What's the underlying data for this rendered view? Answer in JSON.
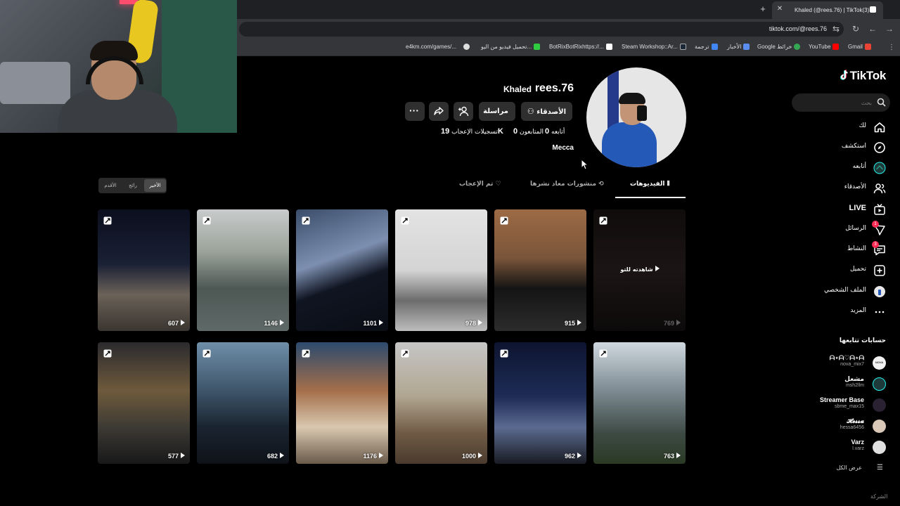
{
  "browser": {
    "tab_title": "Khaled (@rees.76) | TikTok(3)",
    "url": "tiktok.com/@rees.76",
    "bookmarks": [
      "e4km.com/games/...",
      "تحميل فيديو من اليو...",
      "BotRixBotRixhttps://...",
      "Steam Workshop::Ar...",
      "ترجمة",
      "الأخبار",
      "Google خرائط",
      "YouTube",
      "Gmail"
    ]
  },
  "sidebar": {
    "logo": "TikTok",
    "search_placeholder": "بحث",
    "nav": [
      {
        "label": "لك",
        "icon": "home-icon"
      },
      {
        "label": "استكشف",
        "icon": "compass-icon"
      },
      {
        "label": "أتابعه",
        "icon": "following-avatar-icon"
      },
      {
        "label": "الأصدقاء",
        "icon": "friends-icon"
      },
      {
        "label": "LIVE",
        "icon": "live-icon"
      },
      {
        "label": "الرسائل",
        "icon": "messages-icon",
        "badge": "1"
      },
      {
        "label": "النشاط",
        "icon": "activity-icon",
        "badge": "3"
      },
      {
        "label": "تحميل",
        "icon": "upload-icon"
      },
      {
        "label": "الملف الشخصي",
        "icon": "profile-icon"
      },
      {
        "label": "المزيد",
        "icon": "more-icon"
      }
    ],
    "following_heading": "حسابات تتابعها",
    "accounts": [
      {
        "name": "ᗩ⋆ᗩ♡ᗩ⋆ᗩ",
        "handle": "nova_mix7",
        "avatar_text": "NOVA"
      },
      {
        "name": "مشعل",
        "handle": "msh2llm",
        "avatar_text": ""
      },
      {
        "name": "Streamer Base",
        "handle": "sbme_max15",
        "avatar_text": ""
      },
      {
        "name": "𝓗𝓮𝓼𝓼𝓪",
        "handle": "hessa6456",
        "avatar_text": ""
      },
      {
        "name": "Varz",
        "handle": "l.varz",
        "avatar_text": ""
      }
    ],
    "see_all": "عرض الكل",
    "footer": "الشركة"
  },
  "profile": {
    "username": "rees.76",
    "display_name": "Khaled",
    "buttons": {
      "friends": "الأصدقاء",
      "message": "مراسلة"
    },
    "stats": {
      "following_count": "0",
      "following_label": "أتابعه",
      "followers_count": "0",
      "followers_label": "المتابعون",
      "likes_count": "19K",
      "likes_label": "تسجيلات الإعجاب"
    },
    "bio": "Mecca"
  },
  "tabs": {
    "videos": "الفيديوهات",
    "reposts": "منشورات معاد نشرها",
    "liked": "تم الإعجاب"
  },
  "sort": [
    "الأخير",
    "رائج",
    "الأقدم"
  ],
  "videos": [
    {
      "views": "607"
    },
    {
      "views": "1146"
    },
    {
      "views": "1101"
    },
    {
      "views": "978"
    },
    {
      "views": "915"
    },
    {
      "views": "769",
      "overlay": "شاهدته للتو"
    },
    {
      "views": "577"
    },
    {
      "views": "682"
    },
    {
      "views": "1176"
    },
    {
      "views": "1000"
    },
    {
      "views": "962"
    },
    {
      "views": "763"
    }
  ],
  "colors": {
    "accent": "#fe2c55",
    "button": "#2f2f2f",
    "background": "#000000"
  }
}
